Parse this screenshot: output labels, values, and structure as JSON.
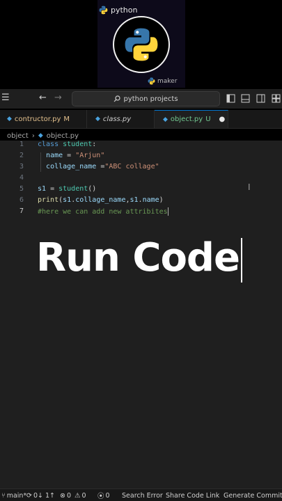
{
  "brand": {
    "top_text": "python",
    "bottom_text": "maker",
    "icon": "python-logo"
  },
  "titlebar": {
    "menu_icon": "hamburger-icon",
    "back_icon": "arrow-left-icon",
    "forward_icon": "arrow-right-icon",
    "search_icon": "search-icon",
    "search_text": "python projects",
    "layout_icons": [
      "layout-sidebar-left-icon",
      "layout-panel-icon",
      "layout-sidebar-right-icon",
      "layout-grid-icon"
    ]
  },
  "tabs": [
    {
      "label": "contructor.py",
      "status": "M",
      "color": "#e2c08d",
      "italic": false,
      "active": false
    },
    {
      "label": "class.py",
      "status": "",
      "color": "#cccccc",
      "italic": true,
      "active": false
    },
    {
      "label": "object.py",
      "status": "U",
      "color": "#73c991",
      "italic": false,
      "active": true,
      "dirty": true
    }
  ],
  "breadcrumb": {
    "folder": "object",
    "separator": "›",
    "file": "object.py"
  },
  "editor": {
    "lines": [
      {
        "n": "1",
        "tokens": [
          [
            "kw",
            "class "
          ],
          [
            "cls",
            "student"
          ],
          [
            "pl",
            ":"
          ]
        ]
      },
      {
        "n": "2",
        "tokens": [
          [
            "pl",
            "  "
          ],
          [
            "var",
            "name"
          ],
          [
            "pl",
            " = "
          ],
          [
            "str",
            "\"Arjun\""
          ]
        ]
      },
      {
        "n": "3",
        "tokens": [
          [
            "pl",
            "  "
          ],
          [
            "var",
            "collage_name"
          ],
          [
            "pl",
            " ="
          ],
          [
            "str",
            "\"ABC collage\""
          ]
        ]
      },
      {
        "n": "4",
        "tokens": []
      },
      {
        "n": "5",
        "tokens": [
          [
            "var",
            "s1"
          ],
          [
            "pl",
            " = "
          ],
          [
            "cls",
            "student"
          ],
          [
            "pl",
            "()"
          ]
        ]
      },
      {
        "n": "6",
        "tokens": [
          [
            "fn",
            "print"
          ],
          [
            "pl",
            "("
          ],
          [
            "var",
            "s1"
          ],
          [
            "pl",
            "."
          ],
          [
            "var",
            "collage_name"
          ],
          [
            "pl",
            ","
          ],
          [
            "var",
            "s1"
          ],
          [
            "pl",
            "."
          ],
          [
            "var",
            "name"
          ],
          [
            "pl",
            ")"
          ]
        ]
      },
      {
        "n": "7",
        "tokens": [
          [
            "cm",
            "#here we can add new attribites"
          ]
        ],
        "current": true
      }
    ]
  },
  "overlay": {
    "caption": "Run Code"
  },
  "statusbar": {
    "branch": "main*",
    "sync": "0↓ 1↑",
    "errors": "0",
    "warnings": "0",
    "ports": "0",
    "items": [
      "Search Error",
      "Share Code Link",
      "Generate Commit M"
    ]
  },
  "colors": {
    "accent": "#0078d4",
    "editor_bg": "#1f1f1f",
    "python_blue": "#3776ab",
    "python_yellow": "#ffd43b"
  }
}
